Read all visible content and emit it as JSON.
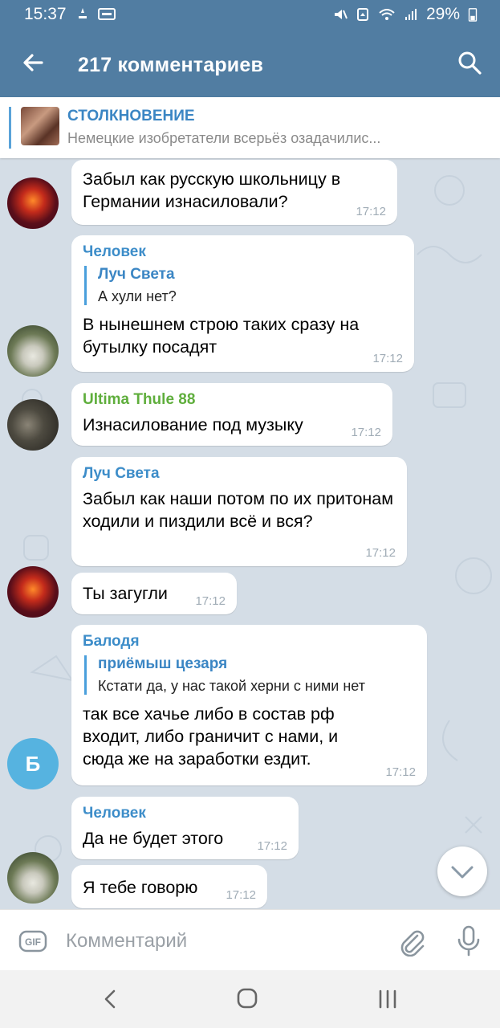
{
  "status_bar": {
    "time": "15:37",
    "battery": "29%"
  },
  "header": {
    "title": "217 комментариев"
  },
  "pinned": {
    "title": "СТОЛКНОВЕНИЕ",
    "text": "Немецкие изобретатели всерьёз озадачилис..."
  },
  "messages": [
    {
      "text": "Забыл как русскую школьницу в Германии изнасиловали?",
      "time": "17:12"
    },
    {
      "name": "Человек",
      "reply_name": "Луч Света",
      "reply_text": "А хули нет?",
      "text": "В нынешнем строю таких сразу на бутылку посадят",
      "time": "17:12"
    },
    {
      "name": "Ultima Thule 88",
      "text": "Изнасилование под музыку",
      "time": "17:12"
    },
    {
      "name": "Луч Света",
      "text": "Забыл как наши потом по их притонам ходили и пиздили всё и вся?",
      "time": "17:12"
    },
    {
      "text": "Ты загугли",
      "time": "17:12"
    },
    {
      "name": "Балодя",
      "reply_name": "приёмыш цезаря",
      "reply_text": "Кстати да, у нас такой херни с ними нет",
      "text": "так все хачье либо в состав рф входит, либо граничит с нами, и сюда же на заработки ездит.",
      "time": "17:12",
      "avatar_letter": "Б"
    },
    {
      "name": "Человек",
      "text": "Да не будет этого",
      "time": "17:12"
    },
    {
      "text": "Я тебе говорю",
      "time": "17:12"
    }
  ],
  "input": {
    "placeholder": "Комментарий"
  },
  "colors": {
    "header": "#517da2",
    "accent": "#3d8dc9",
    "green_name": "#5fae3c",
    "chat_bg": "#d4dde6"
  }
}
